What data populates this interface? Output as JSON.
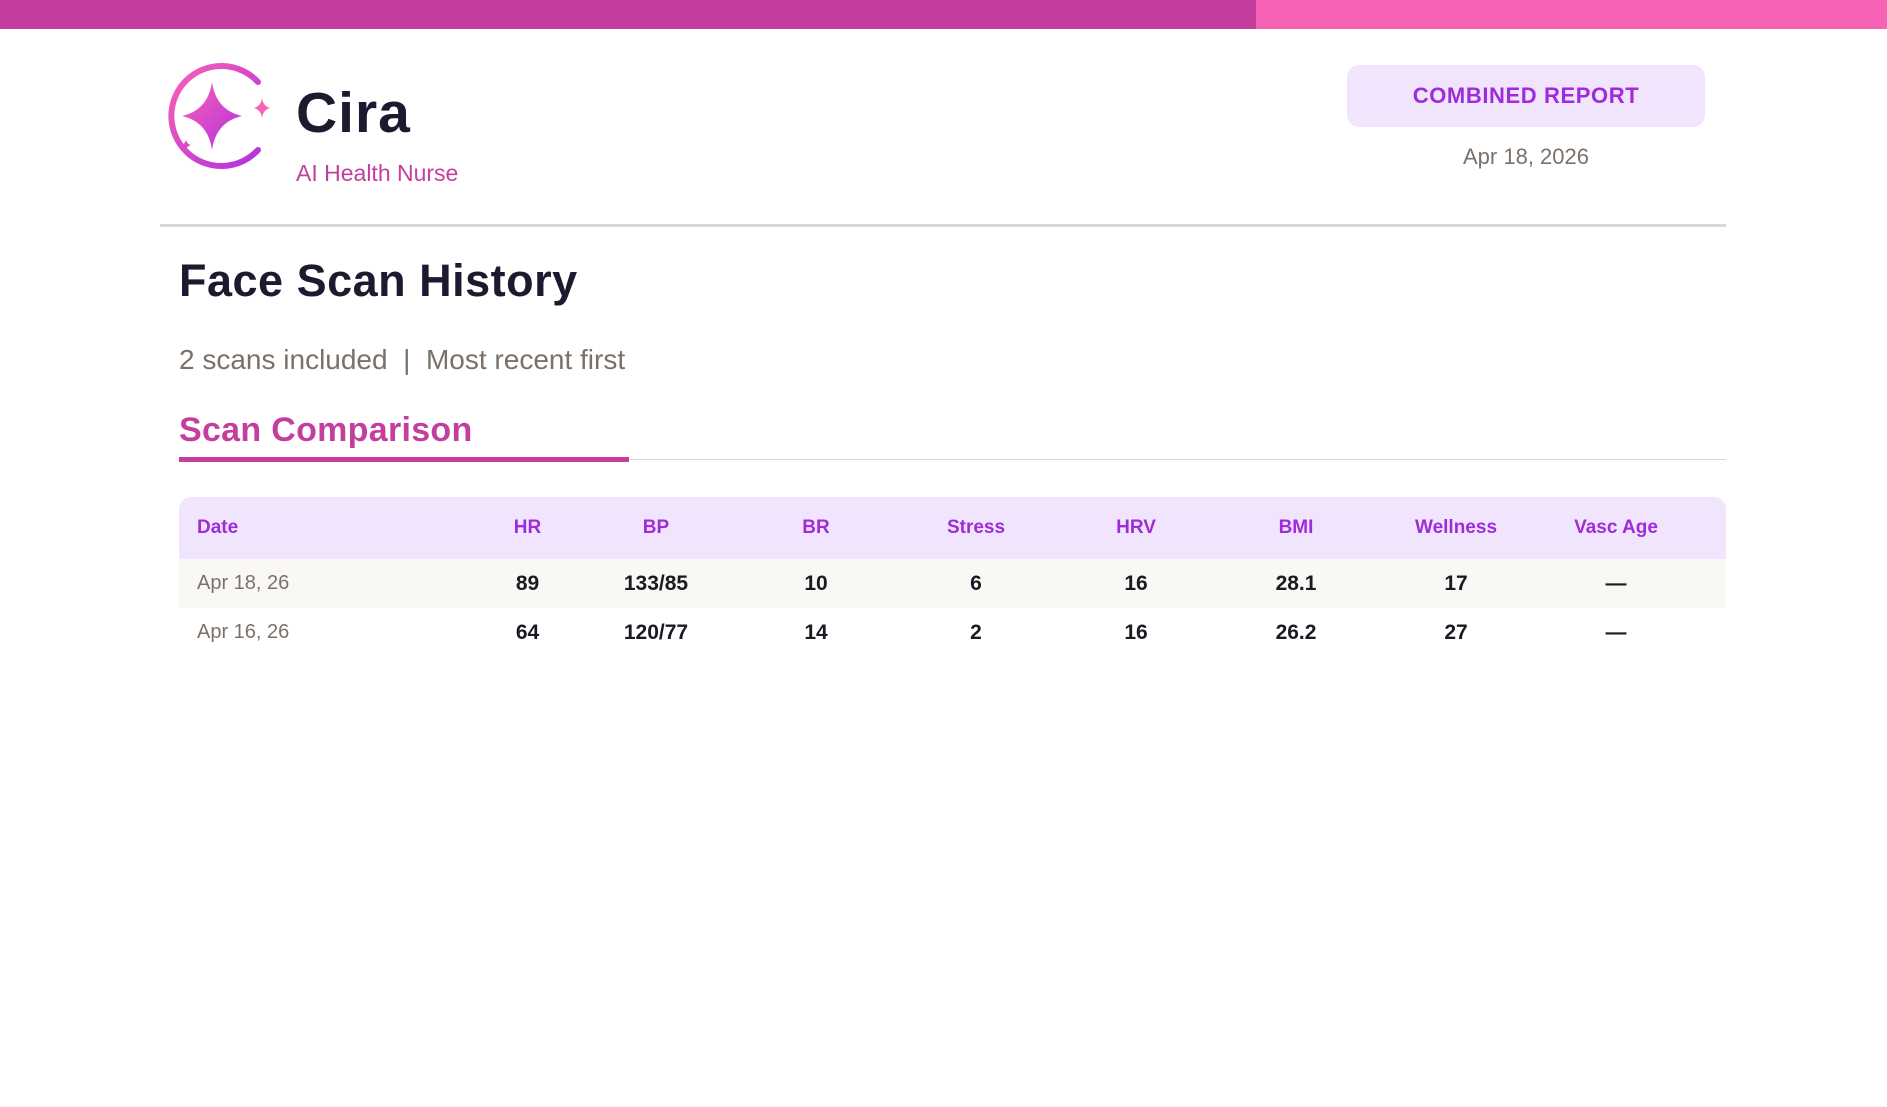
{
  "brand": {
    "name": "Cira",
    "subtitle": "AI Health Nurse",
    "logo_icon": "sparkle-ring-icon",
    "colors": {
      "primary": "#c43f9d",
      "accent": "#f862b4",
      "purple": "#9f2bd9"
    }
  },
  "report": {
    "badge": "COMBINED REPORT",
    "date": "Apr 18, 2026"
  },
  "page": {
    "title": "Face Scan History",
    "summary": "2 scans included  |  Most recent first"
  },
  "section": {
    "title": "Scan Comparison"
  },
  "table": {
    "headers": [
      "Date",
      "HR",
      "BP",
      "BR",
      "Stress",
      "HRV",
      "BMI",
      "Wellness",
      "Vasc Age"
    ],
    "rows": [
      [
        "Apr 18, 26",
        "89",
        "133/85",
        "10",
        "6",
        "16",
        "28.1",
        "17",
        "—"
      ],
      [
        "Apr 16, 26",
        "64",
        "120/77",
        "14",
        "2",
        "16",
        "26.2",
        "27",
        "—"
      ]
    ]
  }
}
